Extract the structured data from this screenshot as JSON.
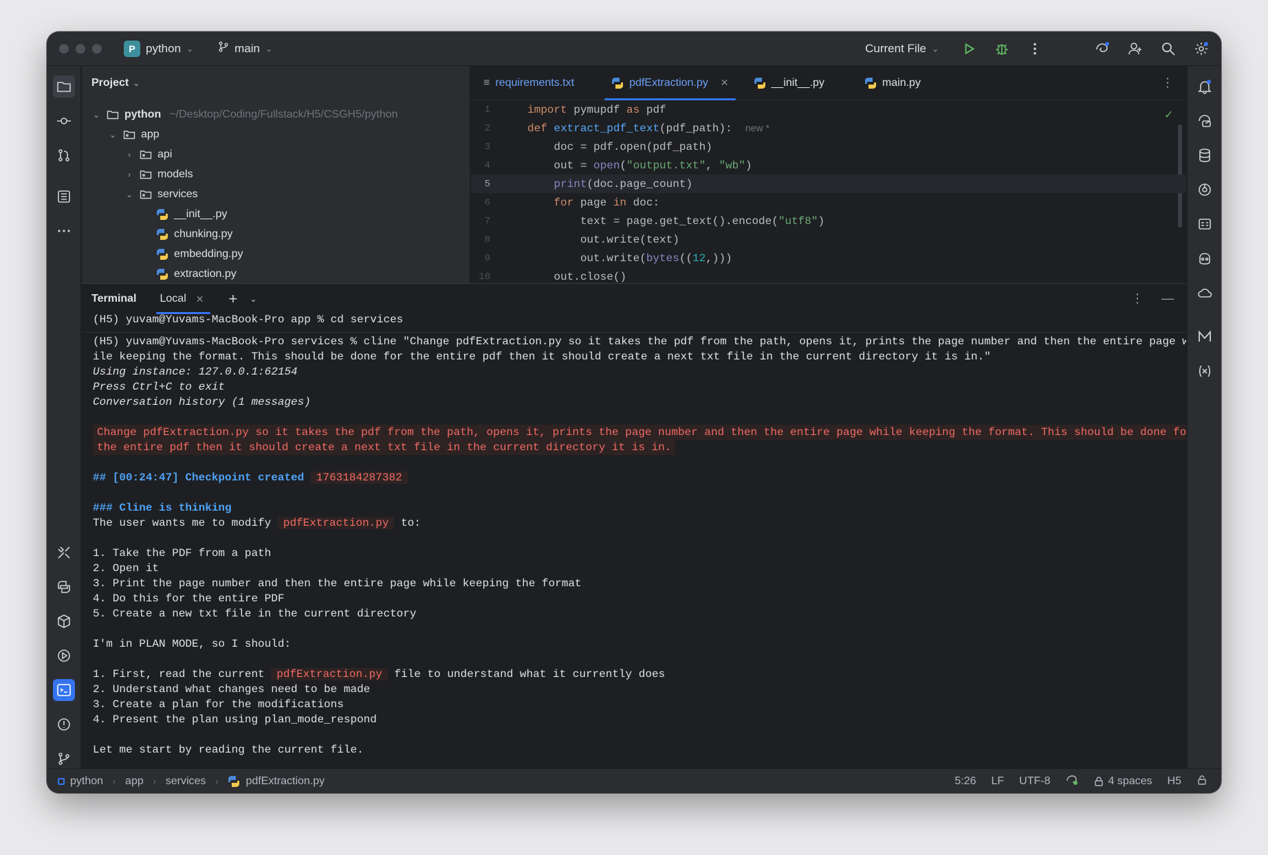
{
  "titlebar": {
    "project_initial": "P",
    "project_name": "python",
    "branch": "main",
    "run_config": "Current File"
  },
  "project_panel": {
    "title": "Project",
    "root_name": "python",
    "root_path": "~/Desktop/Coding/Fullstack/H5/CSGH5/python",
    "items": [
      {
        "label": "app"
      },
      {
        "label": "api"
      },
      {
        "label": "models"
      },
      {
        "label": "services"
      },
      {
        "label": "__init__.py"
      },
      {
        "label": "chunking.py"
      },
      {
        "label": "embedding.py"
      },
      {
        "label": "extraction.py"
      }
    ]
  },
  "editor": {
    "tabs": [
      {
        "label": "requirements.txt"
      },
      {
        "label": "pdfExtraction.py"
      },
      {
        "label": "__init__.py"
      },
      {
        "label": "main.py"
      }
    ],
    "line_numbers": [
      "1",
      "2",
      "3",
      "4",
      "5",
      "6",
      "7",
      "8",
      "9",
      "10"
    ],
    "current_line": 5,
    "inlay_hint": "new *"
  },
  "terminal": {
    "title": "Terminal",
    "tab_label": "Local",
    "lines": {
      "cd": "(H5) yuvam@Yuvams-MacBook-Pro app % cd services",
      "cmd1": "(H5) yuvam@Yuvams-MacBook-Pro services % cline \"Change pdfExtraction.py so it takes the pdf from the path, opens it, prints the page number and then the entire page wh",
      "cmd2": "ile keeping the format. This should be done for the entire pdf then it should create a next txt file in the current directory it is in.\"",
      "instance": "Using instance: 127.0.0.1:62154",
      "press": "Press Ctrl+C to exit",
      "history": "Conversation history (1 messages)",
      "msg1": "Change pdfExtraction.py so it takes the pdf from the path, opens it, prints the page number and then the entire page while keeping the format. This should be done for",
      "msg2": "the entire pdf then it should create a next txt file in the current directory it is in.",
      "checkpoint_head": "## [00:24:47] Checkpoint created",
      "checkpoint_id": "1763184287382",
      "thinking_head": "### Cline is thinking",
      "user_wants_pre": "The user wants me to modify ",
      "file_ref": "pdfExtraction.py",
      "user_wants_post": " to:",
      "steps": [
        "1. Take the PDF from a path",
        "2. Open it",
        "3. Print the page number and then the entire page while keeping the format",
        "4. Do this for the entire PDF",
        "5. Create a new txt file in the current directory"
      ],
      "plan_mode": "I'm in PLAN MODE, so I should:",
      "plan_1_pre": "1. First, read the current ",
      "plan_1_post": " file to understand what it currently does",
      "plan_steps": [
        "2. Understand what changes need to be made",
        "3. Create a plan for the modifications",
        "4. Present the plan using plan_mode_respond"
      ],
      "last": "Let me start by reading the current file."
    }
  },
  "statusbar": {
    "crumbs": [
      "python",
      "app",
      "services",
      "pdfExtraction.py"
    ],
    "position": "5:26",
    "line_sep": "LF",
    "encoding": "UTF-8",
    "indent": "4 spaces",
    "interpreter": "H5"
  },
  "colors": {
    "accent": "#3574f0",
    "keyword": "#cf8e6d",
    "function": "#56a8f5",
    "string": "#6aab73",
    "highlight_red": "#f06a63",
    "heading_blue": "#4ea3f7"
  }
}
